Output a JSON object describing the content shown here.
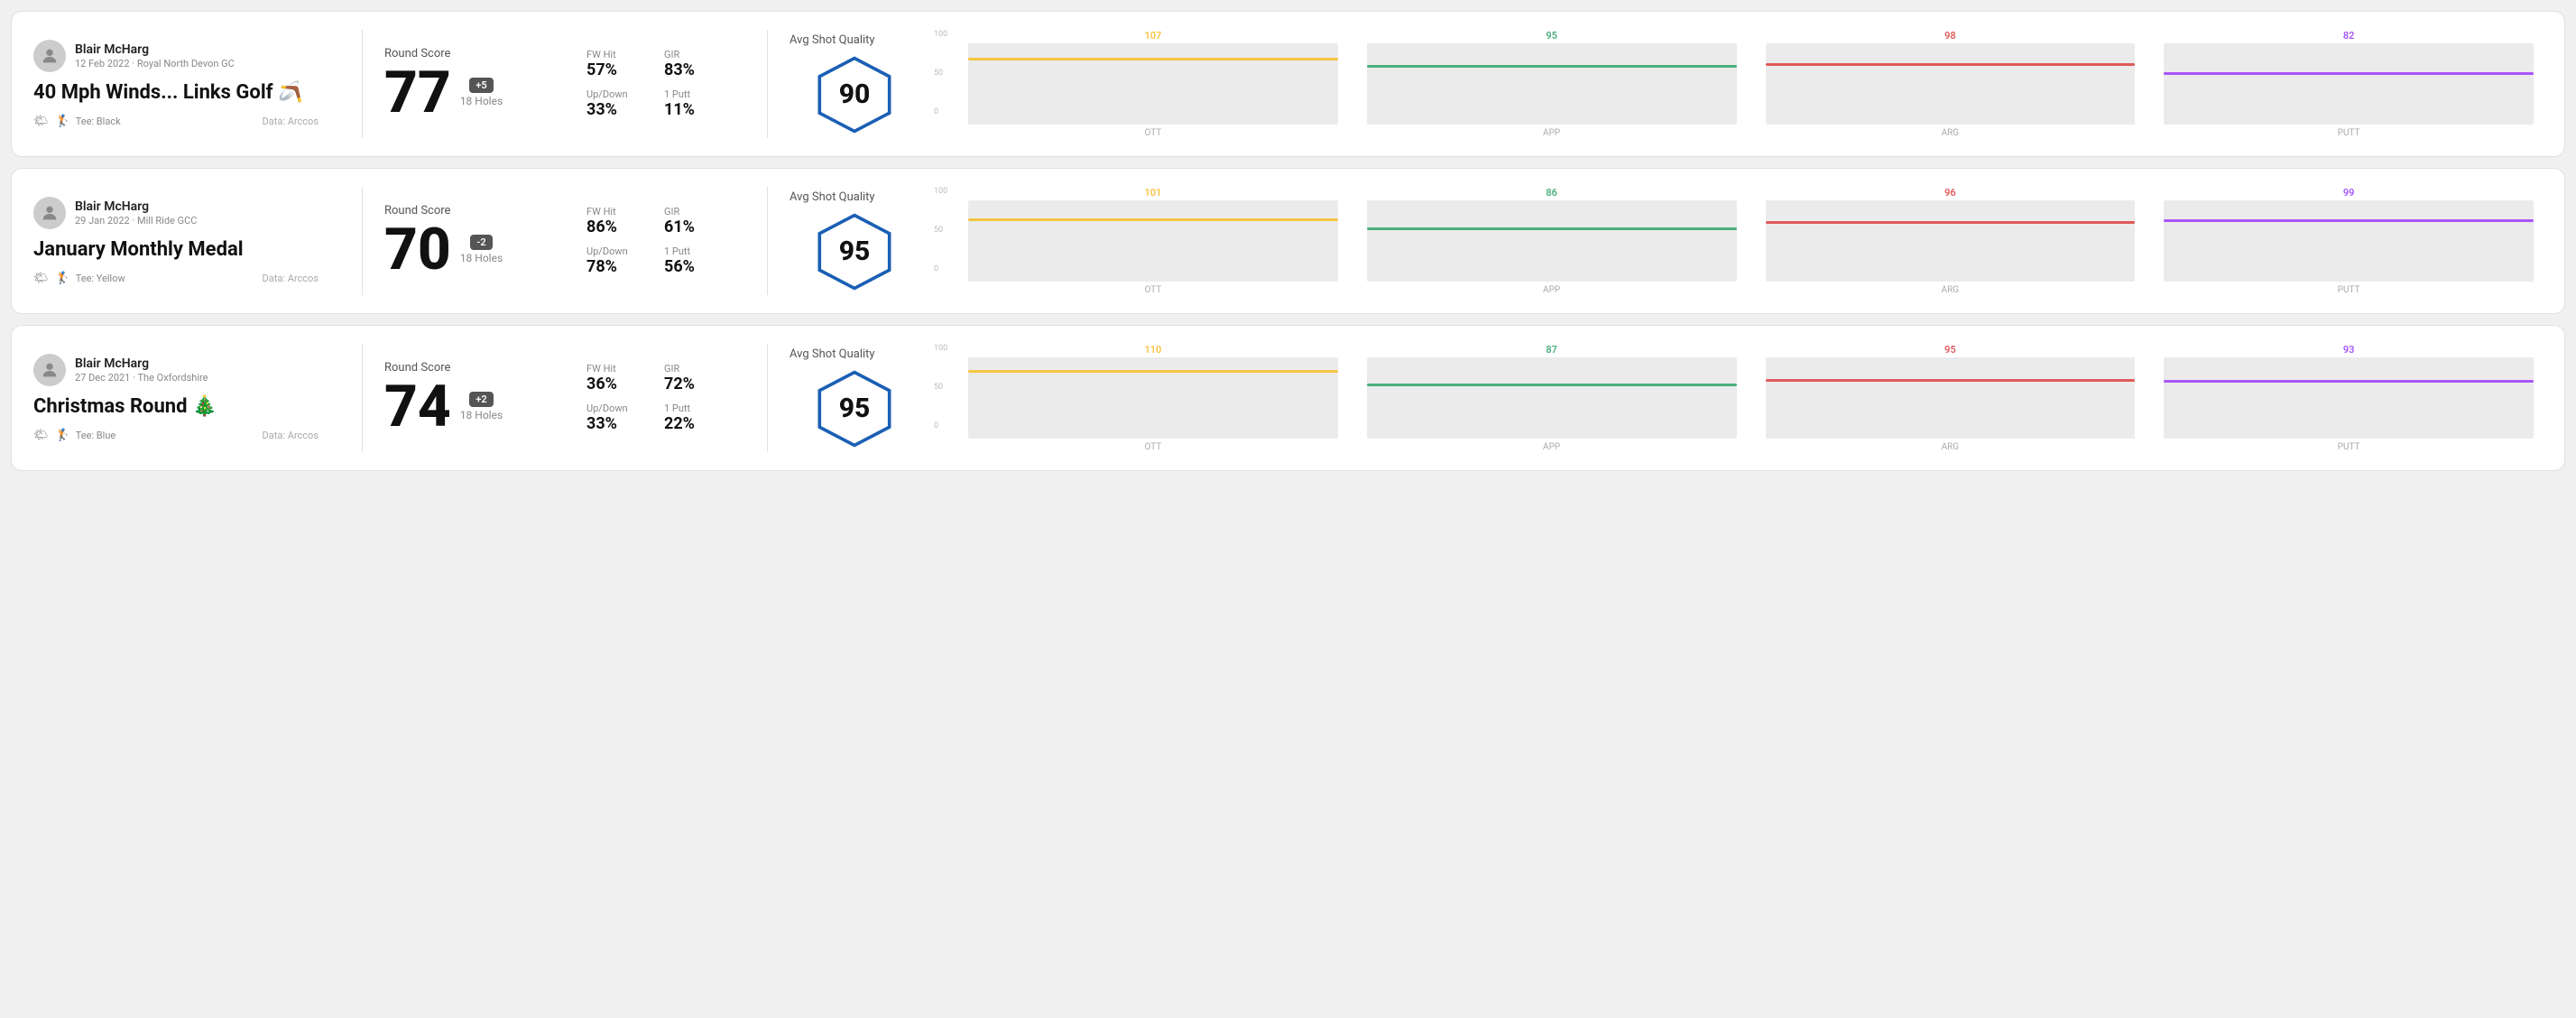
{
  "rounds": [
    {
      "id": "round-1",
      "player_name": "Blair McHarg",
      "date": "12 Feb 2022 · Royal North Devon GC",
      "title": "40 Mph Winds... Links Golf 🪃",
      "tee": "Tee: Black",
      "data_source": "Data: Arccos",
      "round_score_label": "Round Score",
      "score": "77",
      "score_diff": "+5",
      "holes": "18 Holes",
      "fw_hit_label": "FW Hit",
      "fw_hit": "57%",
      "gir_label": "GIR",
      "gir": "83%",
      "updown_label": "Up/Down",
      "updown": "33%",
      "oneputt_label": "1 Putt",
      "oneputt": "11%",
      "quality_label": "Avg Shot Quality",
      "quality_score": "90",
      "chart": {
        "bars": [
          {
            "label": "OTT",
            "value": 107,
            "color": "#f5c542",
            "max": 120
          },
          {
            "label": "APP",
            "value": 95,
            "color": "#4caf7d",
            "max": 120
          },
          {
            "label": "ARG",
            "value": 98,
            "color": "#e05a5a",
            "max": 120
          },
          {
            "label": "PUTT",
            "value": 82,
            "color": "#a855f7",
            "max": 120
          }
        ],
        "y_labels": [
          "100",
          "50",
          "0"
        ]
      }
    },
    {
      "id": "round-2",
      "player_name": "Blair McHarg",
      "date": "29 Jan 2022 · Mill Ride GCC",
      "title": "January Monthly Medal",
      "tee": "Tee: Yellow",
      "data_source": "Data: Arccos",
      "round_score_label": "Round Score",
      "score": "70",
      "score_diff": "-2",
      "holes": "18 Holes",
      "fw_hit_label": "FW Hit",
      "fw_hit": "86%",
      "gir_label": "GIR",
      "gir": "61%",
      "updown_label": "Up/Down",
      "updown": "78%",
      "oneputt_label": "1 Putt",
      "oneputt": "56%",
      "quality_label": "Avg Shot Quality",
      "quality_score": "95",
      "chart": {
        "bars": [
          {
            "label": "OTT",
            "value": 101,
            "color": "#f5c542",
            "max": 120
          },
          {
            "label": "APP",
            "value": 86,
            "color": "#4caf7d",
            "max": 120
          },
          {
            "label": "ARG",
            "value": 96,
            "color": "#e05a5a",
            "max": 120
          },
          {
            "label": "PUTT",
            "value": 99,
            "color": "#a855f7",
            "max": 120
          }
        ],
        "y_labels": [
          "100",
          "50",
          "0"
        ]
      }
    },
    {
      "id": "round-3",
      "player_name": "Blair McHarg",
      "date": "27 Dec 2021 · The Oxfordshire",
      "title": "Christmas Round 🎄",
      "tee": "Tee: Blue",
      "data_source": "Data: Arccos",
      "round_score_label": "Round Score",
      "score": "74",
      "score_diff": "+2",
      "holes": "18 Holes",
      "fw_hit_label": "FW Hit",
      "fw_hit": "36%",
      "gir_label": "GIR",
      "gir": "72%",
      "updown_label": "Up/Down",
      "updown": "33%",
      "oneputt_label": "1 Putt",
      "oneputt": "22%",
      "quality_label": "Avg Shot Quality",
      "quality_score": "95",
      "chart": {
        "bars": [
          {
            "label": "OTT",
            "value": 110,
            "color": "#f5c542",
            "max": 120
          },
          {
            "label": "APP",
            "value": 87,
            "color": "#4caf7d",
            "max": 120
          },
          {
            "label": "ARG",
            "value": 95,
            "color": "#e05a5a",
            "max": 120
          },
          {
            "label": "PUTT",
            "value": 93,
            "color": "#a855f7",
            "max": 120
          }
        ],
        "y_labels": [
          "100",
          "50",
          "0"
        ]
      }
    }
  ]
}
